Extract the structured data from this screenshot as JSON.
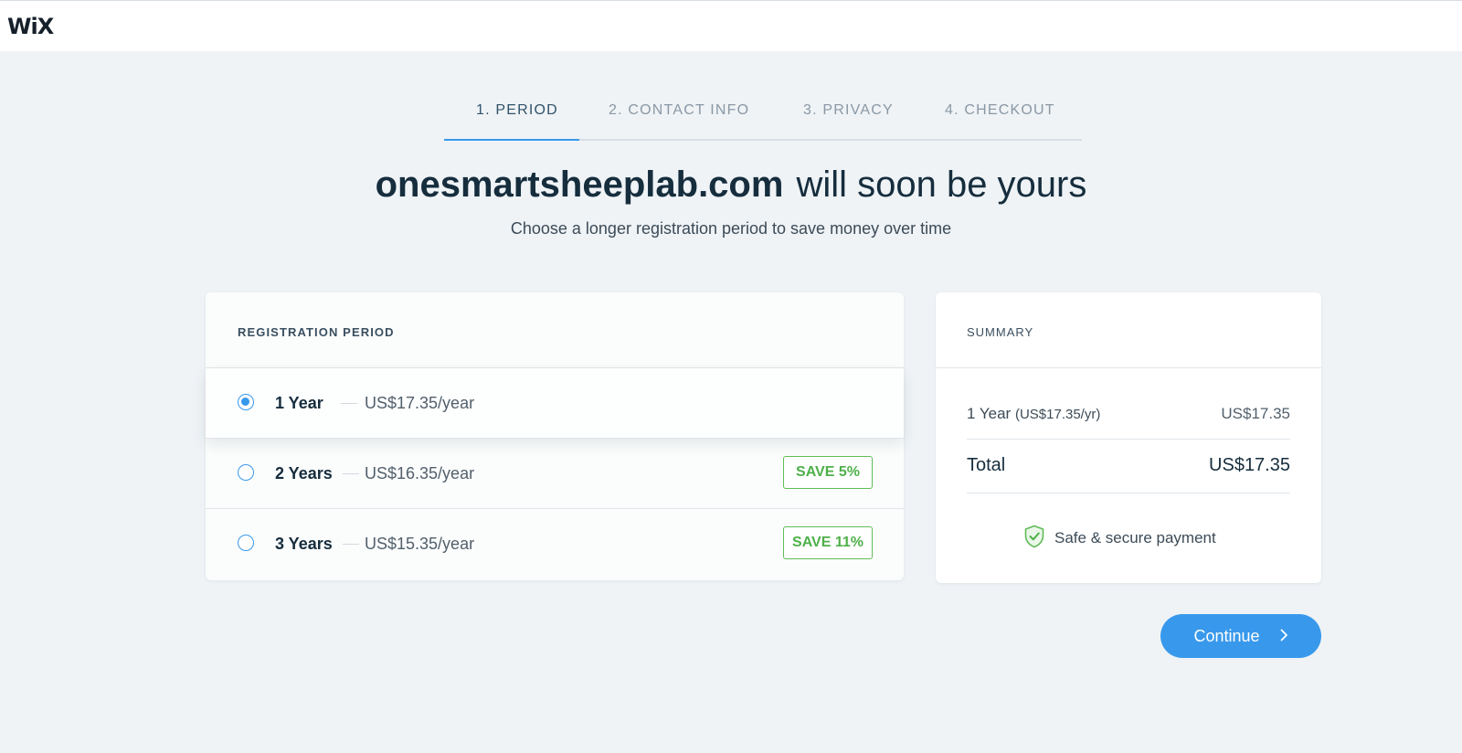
{
  "header": {
    "logo": "WiX"
  },
  "stepper": {
    "steps": [
      {
        "label": "1.  PERIOD",
        "active": true
      },
      {
        "label": "2.  CONTACT INFO",
        "active": false
      },
      {
        "label": "3.  PRIVACY",
        "active": false
      },
      {
        "label": "4.  CHECKOUT",
        "active": false
      }
    ]
  },
  "headline": {
    "domain": "onesmartsheeplab.com",
    "suffix": "will soon be yours"
  },
  "subhead": "Choose a longer registration period to save money over time",
  "registration": {
    "title": "REGISTRATION PERIOD",
    "options": [
      {
        "label": "1 Year",
        "price": "US$17.35/year",
        "selected": true,
        "badge": ""
      },
      {
        "label": "2 Years",
        "price": "US$16.35/year",
        "selected": false,
        "badge": "SAVE 5%"
      },
      {
        "label": "3 Years",
        "price": "US$15.35/year",
        "selected": false,
        "badge": "SAVE 11%"
      }
    ]
  },
  "summary": {
    "title": "SUMMARY",
    "item_label": "1 Year",
    "item_detail": "(US$17.35/yr)",
    "item_price": "US$17.35",
    "total_label": "Total",
    "total_value": "US$17.35",
    "secure_text": "Safe & secure payment",
    "secure_icon": "shield-check-icon"
  },
  "actions": {
    "continue_label": "Continue",
    "continue_icon": "chevron-right-icon"
  },
  "colors": {
    "accent": "#3899ec",
    "save_green": "#60bc57",
    "background": "#eff3f6"
  }
}
